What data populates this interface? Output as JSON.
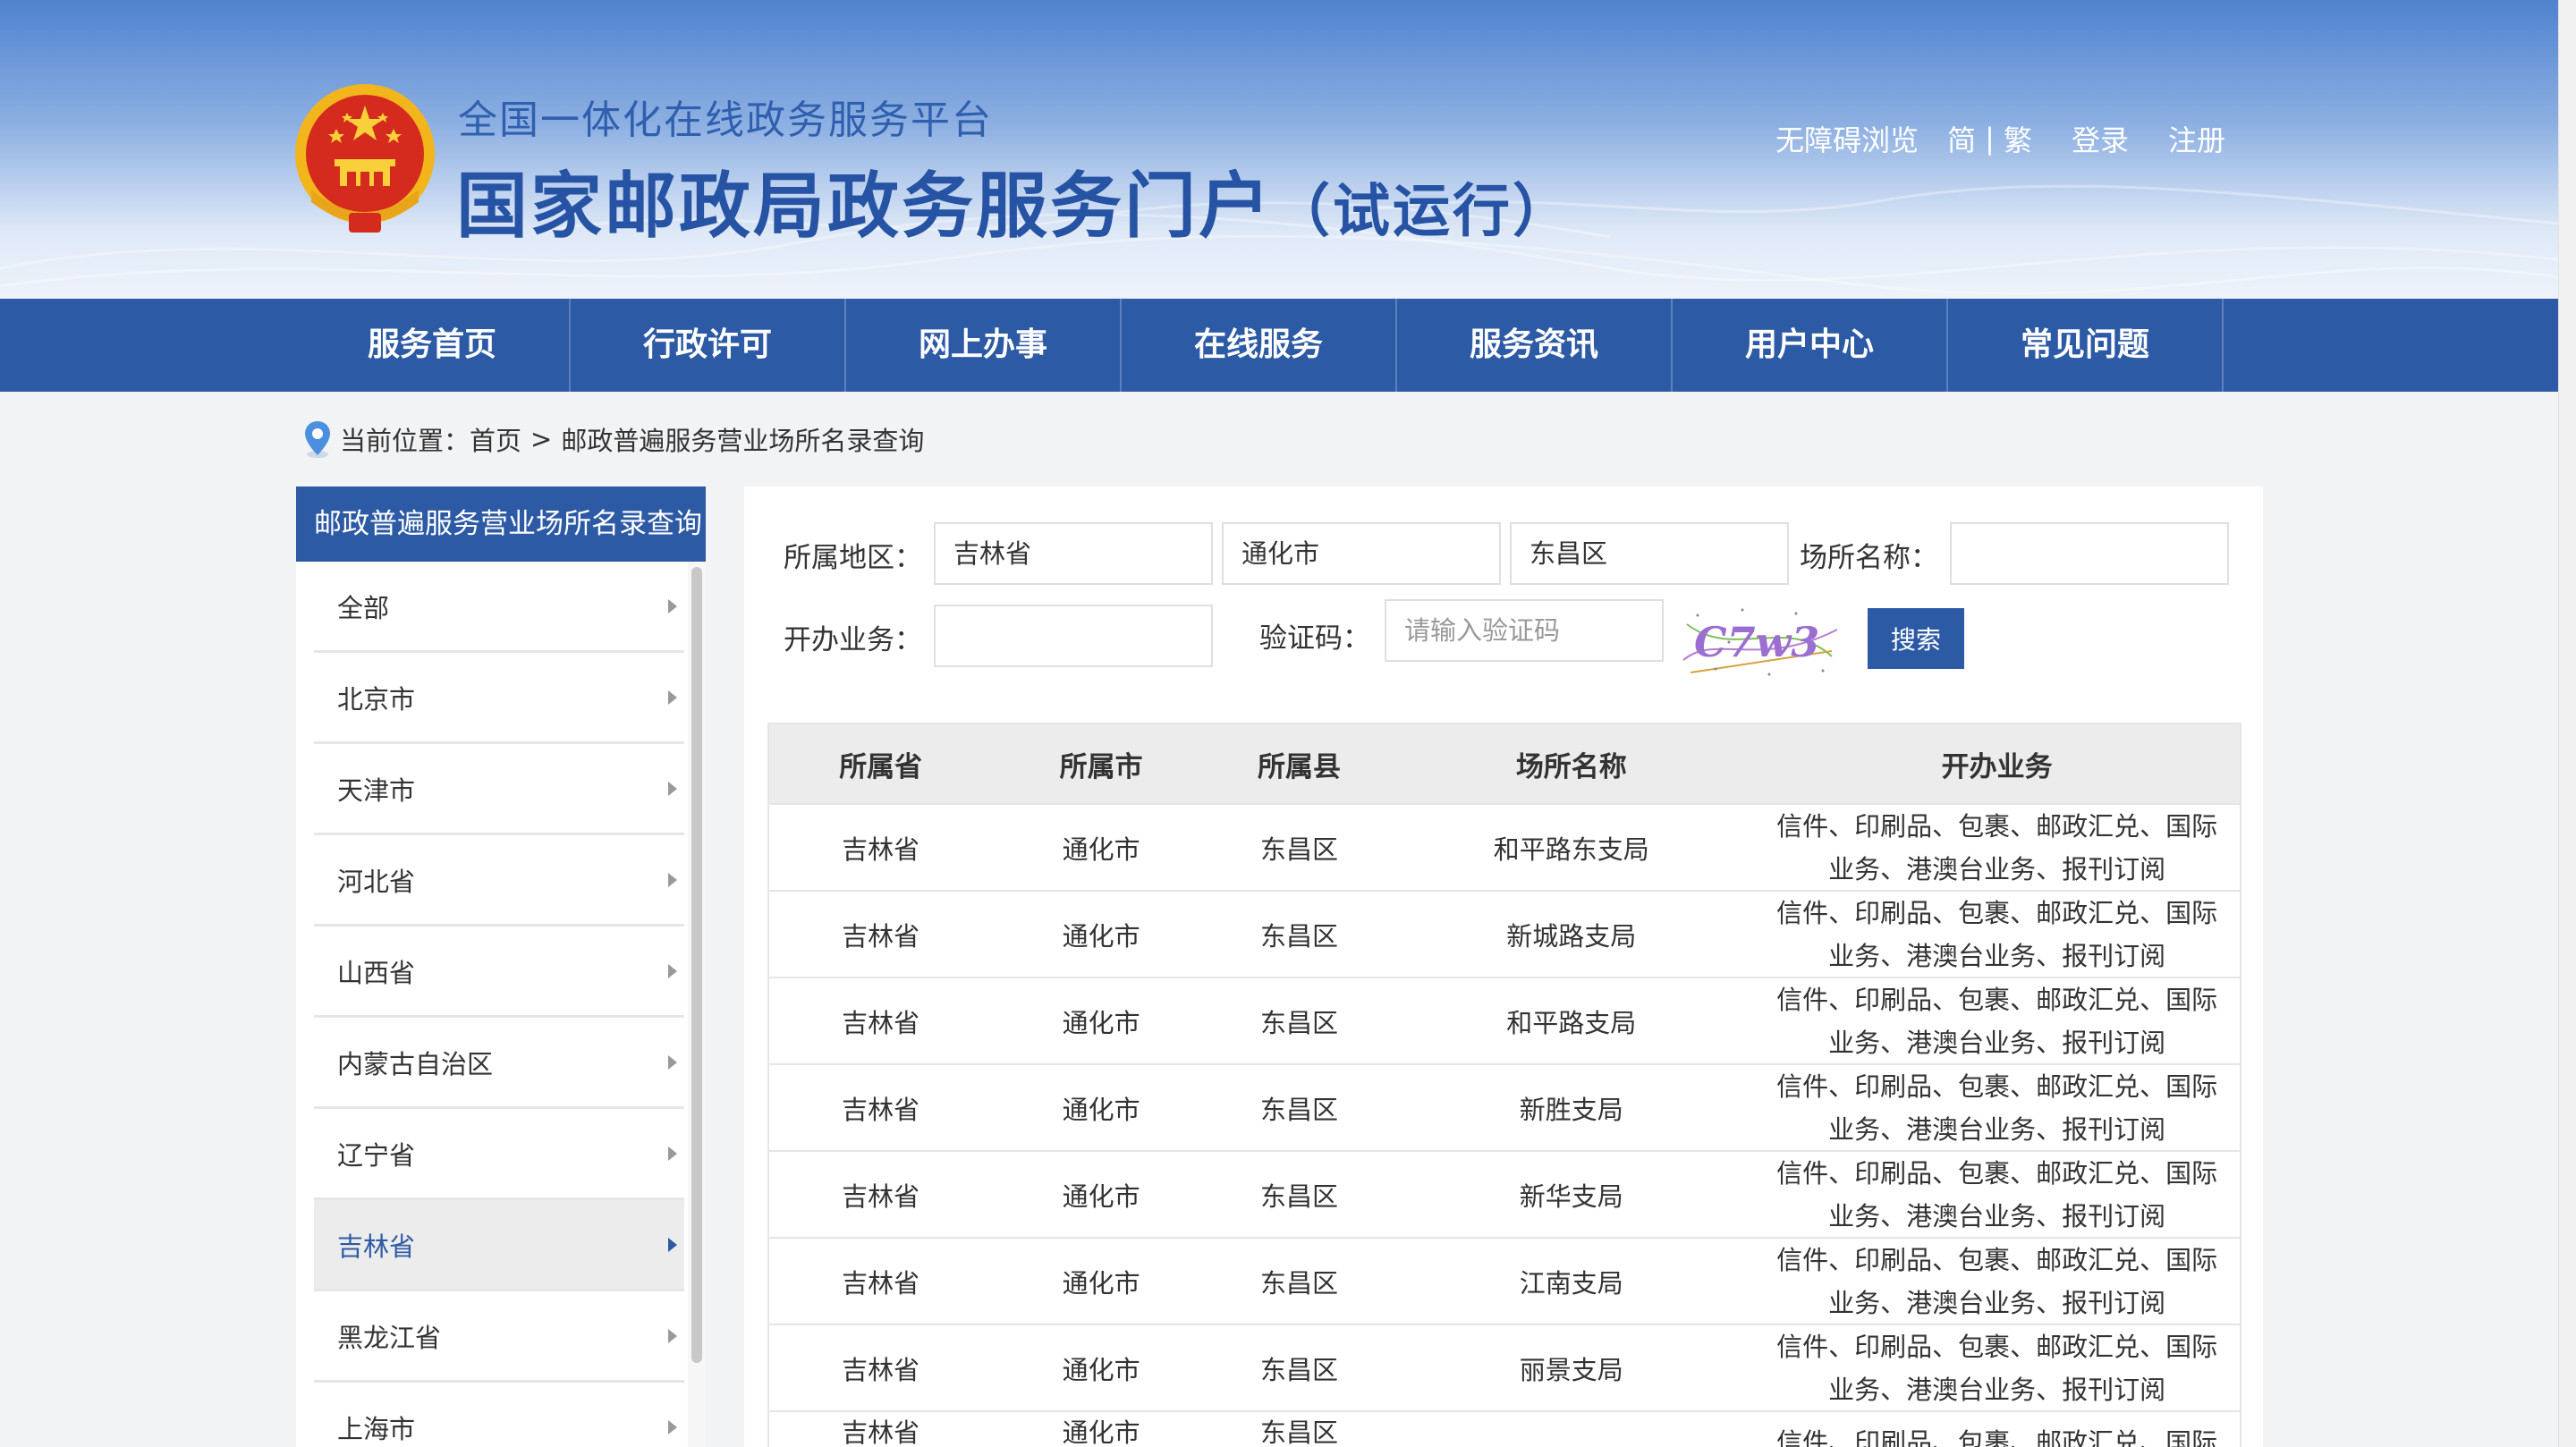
{
  "header": {
    "subtitle": "全国一体化在线政务服务平台",
    "title": "国家邮政局政务服务门户",
    "title_suffix": "（试运行）",
    "links": {
      "accessibility": "无障碍浏览",
      "simplified": "简",
      "separator": "|",
      "traditional": "繁",
      "login": "登录",
      "register": "注册"
    }
  },
  "nav": {
    "items": [
      {
        "label": "服务首页"
      },
      {
        "label": "行政许可"
      },
      {
        "label": "网上办事"
      },
      {
        "label": "在线服务"
      },
      {
        "label": "服务资讯"
      },
      {
        "label": "用户中心"
      },
      {
        "label": "常见问题"
      }
    ]
  },
  "breadcrumb": {
    "prefix": "当前位置：",
    "home": "首页",
    "separator": ">",
    "current": "邮政普遍服务营业场所名录查询"
  },
  "sidebar": {
    "title": "邮政普遍服务营业场所名录查询",
    "items": [
      {
        "label": "全部"
      },
      {
        "label": "北京市"
      },
      {
        "label": "天津市"
      },
      {
        "label": "河北省"
      },
      {
        "label": "山西省"
      },
      {
        "label": "内蒙古自治区"
      },
      {
        "label": "辽宁省"
      },
      {
        "label": "吉林省",
        "active": true
      },
      {
        "label": "黑龙江省"
      },
      {
        "label": "上海市"
      }
    ]
  },
  "form": {
    "region_label": "所属地区：",
    "province_value": "吉林省",
    "city_value": "通化市",
    "district_value": "东昌区",
    "place_name_label": "场所名称：",
    "place_name_value": "",
    "business_label": "开办业务：",
    "business_value": "",
    "captcha_label": "验证码：",
    "captcha_placeholder": "请输入验证码",
    "captcha_text": "C7w3",
    "search_label": "搜索"
  },
  "table": {
    "headers": [
      "所属省",
      "所属市",
      "所属县",
      "场所名称",
      "开办业务"
    ],
    "rows": [
      [
        "吉林省",
        "通化市",
        "东昌区",
        "和平路东支局",
        "信件、印刷品、包裹、邮政汇兑、国际业务、港澳台业务、报刊订阅"
      ],
      [
        "吉林省",
        "通化市",
        "东昌区",
        "新城路支局",
        "信件、印刷品、包裹、邮政汇兑、国际业务、港澳台业务、报刊订阅"
      ],
      [
        "吉林省",
        "通化市",
        "东昌区",
        "和平路支局",
        "信件、印刷品、包裹、邮政汇兑、国际业务、港澳台业务、报刊订阅"
      ],
      [
        "吉林省",
        "通化市",
        "东昌区",
        "新胜支局",
        "信件、印刷品、包裹、邮政汇兑、国际业务、港澳台业务、报刊订阅"
      ],
      [
        "吉林省",
        "通化市",
        "东昌区",
        "新华支局",
        "信件、印刷品、包裹、邮政汇兑、国际业务、港澳台业务、报刊订阅"
      ],
      [
        "吉林省",
        "通化市",
        "东昌区",
        "江南支局",
        "信件、印刷品、包裹、邮政汇兑、国际业务、港澳台业务、报刊订阅"
      ],
      [
        "吉林省",
        "通化市",
        "东昌区",
        "丽景支局",
        "信件、印刷品、包裹、邮政汇兑、国际业务、港澳台业务、报刊订阅"
      ],
      [
        "吉林省",
        "通化市",
        "东昌区",
        "",
        "信件、印刷品、包裹、邮政汇兑、国际业"
      ]
    ]
  },
  "colors": {
    "primary": "#2d5aa5",
    "title_blue": "#2653a3",
    "emblem_red": "#d52b1e",
    "emblem_gold": "#f2b51c"
  },
  "icons": {
    "emblem": "national-emblem-icon",
    "location": "location-pin-icon",
    "sidebar_arrow": "caret-right-icon"
  }
}
